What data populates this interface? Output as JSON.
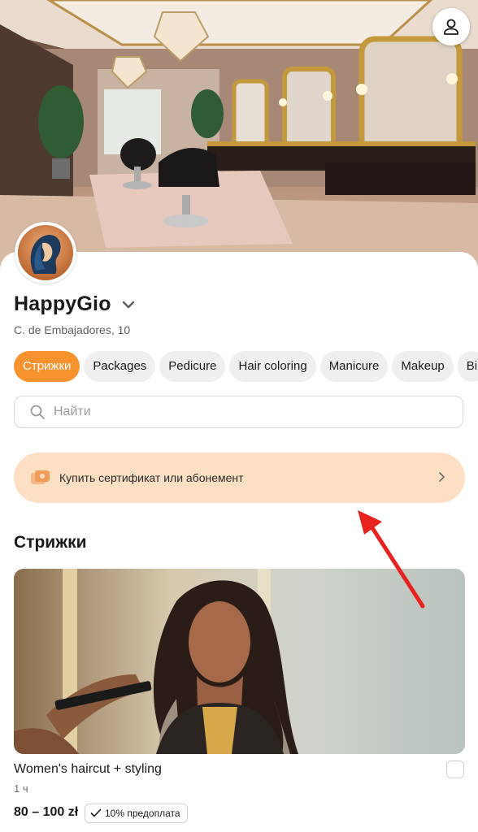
{
  "salon": {
    "name": "HappyGio",
    "address": "C. de Embajadores, 10"
  },
  "categories": [
    "Стрижки",
    "Packages",
    "Pedicure",
    "Hair coloring",
    "Manicure",
    "Makeup",
    "Bi"
  ],
  "active_category": "Стрижки",
  "search": {
    "placeholder": "Найти"
  },
  "banner": {
    "text": "Купить сертификат или абонемент"
  },
  "section": {
    "title": "Стрижки"
  },
  "service": {
    "name": "Women's haircut + styling",
    "duration": "1 ч",
    "price": "80 – 100 zł",
    "prepayment": "10% предоплата"
  },
  "colors": {
    "accent": "#f7932e",
    "banner_bg": "#fde0c4",
    "annotation_arrow": "#e8231f"
  },
  "icons": [
    "user-icon",
    "chevron-down-icon",
    "search-icon",
    "certificate-icon",
    "chevron-right-icon",
    "checkmark-icon"
  ]
}
